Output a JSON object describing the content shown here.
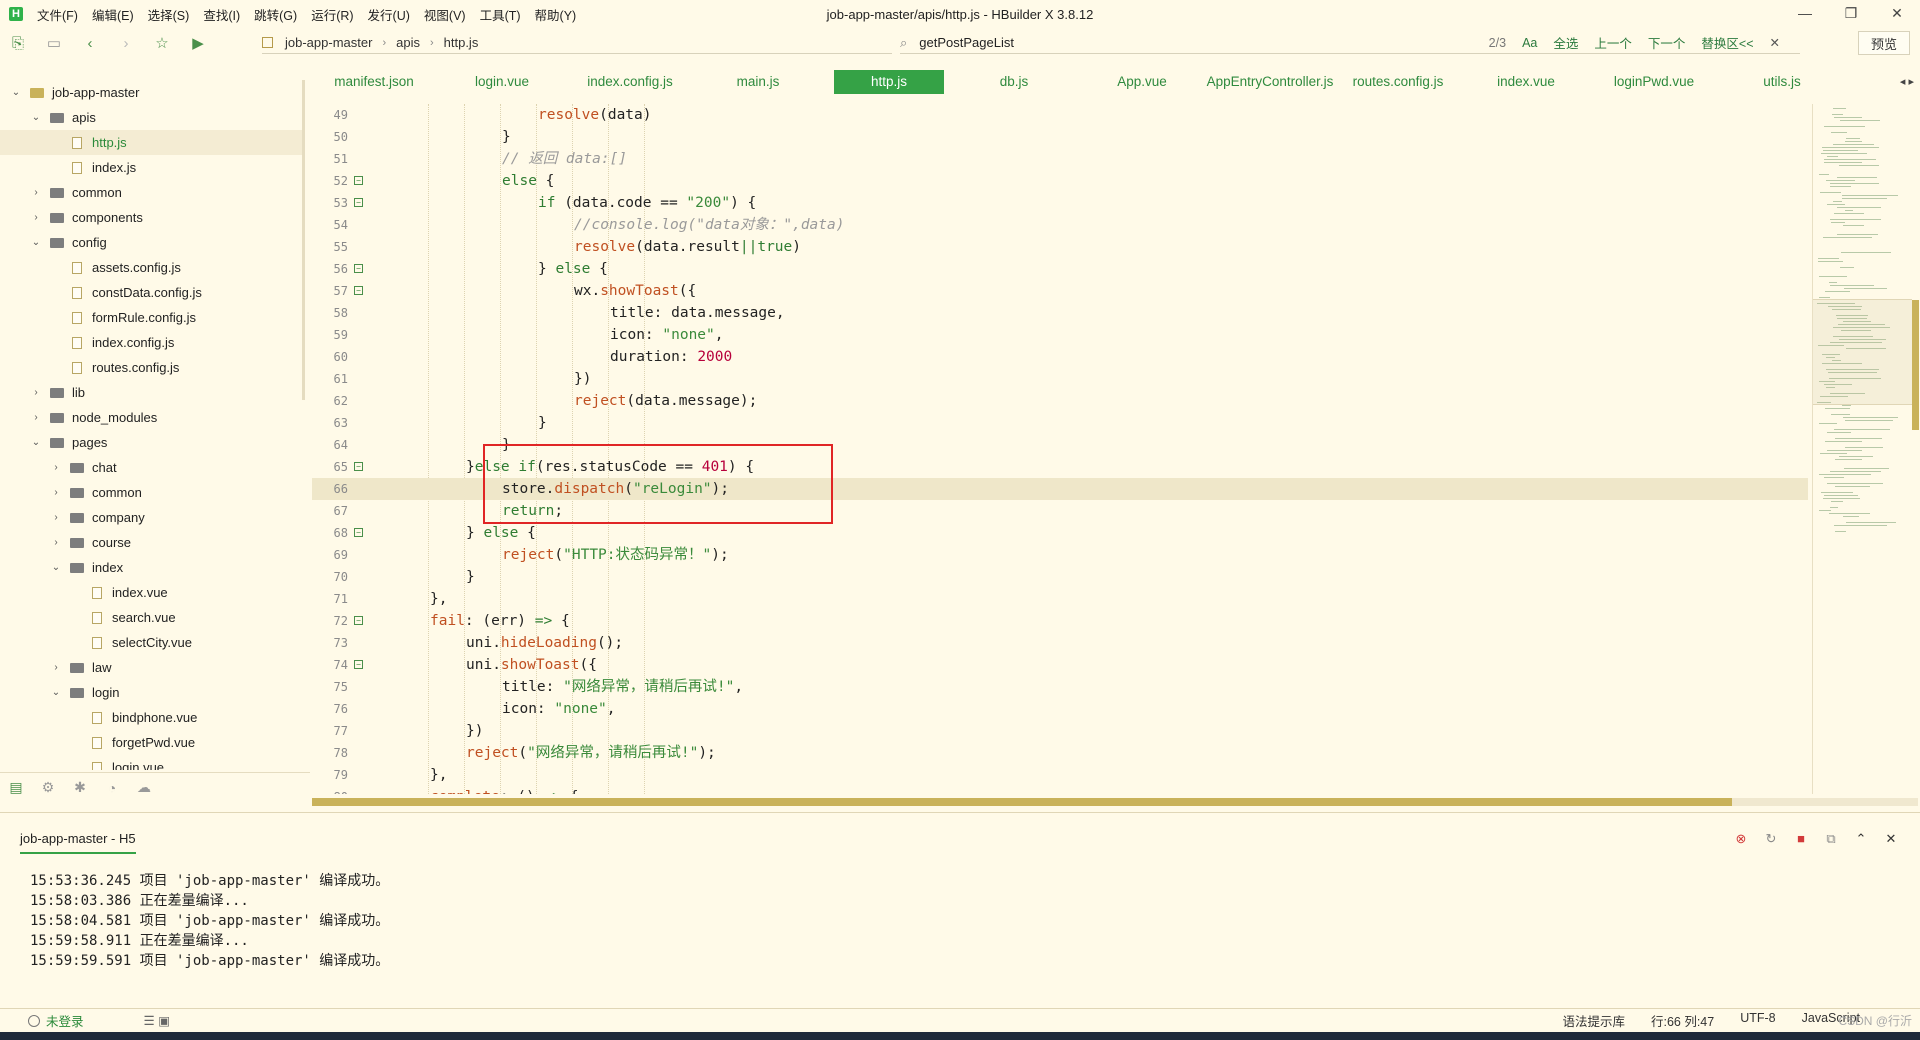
{
  "app": {
    "title": "job-app-master/apis/http.js - HBuilder X 3.8.12",
    "logo_letter": "H",
    "menu": [
      "文件(F)",
      "编辑(E)",
      "选择(S)",
      "查找(I)",
      "跳转(G)",
      "运行(R)",
      "发行(U)",
      "视图(V)",
      "工具(T)",
      "帮助(Y)"
    ]
  },
  "toolbar": {
    "breadcrumb": [
      "job-app-master",
      "apis",
      "http.js"
    ],
    "search_value": "getPostPageList",
    "search_count": "2/3",
    "search_options": [
      "Aa",
      "全选",
      "上一个",
      "下一个",
      "替换区<<"
    ],
    "preview_label": "预览"
  },
  "sidebar": {
    "items": [
      {
        "label": "job-app-master",
        "type": "project",
        "depth": 0,
        "expanded": true
      },
      {
        "label": "apis",
        "type": "folder",
        "depth": 1,
        "expanded": true
      },
      {
        "label": "http.js",
        "type": "file",
        "depth": 2,
        "selected": true
      },
      {
        "label": "index.js",
        "type": "file",
        "depth": 2
      },
      {
        "label": "common",
        "type": "folder",
        "depth": 1,
        "expanded": false
      },
      {
        "label": "components",
        "type": "folder",
        "depth": 1,
        "expanded": false
      },
      {
        "label": "config",
        "type": "folder",
        "depth": 1,
        "expanded": true
      },
      {
        "label": "assets.config.js",
        "type": "file",
        "depth": 2
      },
      {
        "label": "constData.config.js",
        "type": "file",
        "depth": 2
      },
      {
        "label": "formRule.config.js",
        "type": "file",
        "depth": 2
      },
      {
        "label": "index.config.js",
        "type": "file",
        "depth": 2
      },
      {
        "label": "routes.config.js",
        "type": "file",
        "depth": 2
      },
      {
        "label": "lib",
        "type": "folder",
        "depth": 1,
        "expanded": false
      },
      {
        "label": "node_modules",
        "type": "folder",
        "depth": 1,
        "expanded": false
      },
      {
        "label": "pages",
        "type": "folder",
        "depth": 1,
        "expanded": true
      },
      {
        "label": "chat",
        "type": "folder",
        "depth": 2,
        "expanded": false
      },
      {
        "label": "common",
        "type": "folder",
        "depth": 2,
        "expanded": false
      },
      {
        "label": "company",
        "type": "folder",
        "depth": 2,
        "expanded": false
      },
      {
        "label": "course",
        "type": "folder",
        "depth": 2,
        "expanded": false
      },
      {
        "label": "index",
        "type": "folder",
        "depth": 2,
        "expanded": true
      },
      {
        "label": "index.vue",
        "type": "file",
        "depth": 3
      },
      {
        "label": "search.vue",
        "type": "file",
        "depth": 3
      },
      {
        "label": "selectCity.vue",
        "type": "file",
        "depth": 3
      },
      {
        "label": "law",
        "type": "folder",
        "depth": 2,
        "expanded": false
      },
      {
        "label": "login",
        "type": "folder",
        "depth": 2,
        "expanded": true
      },
      {
        "label": "bindphone.vue",
        "type": "file",
        "depth": 3
      },
      {
        "label": "forgetPwd.vue",
        "type": "file",
        "depth": 3
      },
      {
        "label": "login.vue",
        "type": "file",
        "depth": 3
      }
    ]
  },
  "tabs": [
    {
      "label": "manifest.json"
    },
    {
      "label": "login.vue"
    },
    {
      "label": "index.config.js"
    },
    {
      "label": "main.js"
    },
    {
      "label": "http.js",
      "active": true
    },
    {
      "label": "db.js"
    },
    {
      "label": "App.vue"
    },
    {
      "label": "AppEntryController.js"
    },
    {
      "label": "routes.config.js"
    },
    {
      "label": "index.vue"
    },
    {
      "label": "loginPwd.vue"
    },
    {
      "label": "utils.js"
    }
  ],
  "editor": {
    "current_line": 66,
    "highlighted_lines": [
      65,
      66,
      67
    ],
    "lines": [
      {
        "n": "49",
        "indent": 6,
        "fold": false,
        "tokens": [
          [
            "fn",
            "resolve"
          ],
          [
            "p",
            "(data)"
          ]
        ]
      },
      {
        "n": "50",
        "indent": 5,
        "fold": false,
        "tokens": [
          [
            "p",
            "}"
          ]
        ]
      },
      {
        "n": "51",
        "indent": 5,
        "fold": false,
        "tokens": [
          [
            "cmt",
            "// 返回 data:[]"
          ]
        ]
      },
      {
        "n": "52",
        "indent": 5,
        "fold": true,
        "tokens": [
          [
            "kw",
            "else"
          ],
          [
            "p",
            " {"
          ]
        ]
      },
      {
        "n": "53",
        "indent": 6,
        "fold": true,
        "tokens": [
          [
            "kw",
            "if"
          ],
          [
            "p",
            " (data.code == "
          ],
          [
            "str",
            "\"200\""
          ],
          [
            "p",
            ") {"
          ]
        ]
      },
      {
        "n": "54",
        "indent": 7,
        "fold": false,
        "tokens": [
          [
            "cmt",
            "//console.log(\"data对象：\",data)"
          ]
        ]
      },
      {
        "n": "55",
        "indent": 7,
        "fold": false,
        "tokens": [
          [
            "fn",
            "resolve"
          ],
          [
            "p",
            "(data.result"
          ],
          [
            "kw",
            "||"
          ],
          [
            "kw",
            "true"
          ],
          [
            "p",
            ")"
          ]
        ]
      },
      {
        "n": "56",
        "indent": 6,
        "fold": true,
        "tokens": [
          [
            "p",
            "} "
          ],
          [
            "kw",
            "else"
          ],
          [
            "p",
            " {"
          ]
        ]
      },
      {
        "n": "57",
        "indent": 7,
        "fold": true,
        "tokens": [
          [
            "p",
            "wx."
          ],
          [
            "fn",
            "showToast"
          ],
          [
            "p",
            "({"
          ]
        ]
      },
      {
        "n": "58",
        "indent": 8,
        "fold": false,
        "tokens": [
          [
            "p",
            "title: data.message,"
          ]
        ]
      },
      {
        "n": "59",
        "indent": 8,
        "fold": false,
        "tokens": [
          [
            "p",
            "icon: "
          ],
          [
            "str",
            "\"none\""
          ],
          [
            "p",
            ","
          ]
        ]
      },
      {
        "n": "60",
        "indent": 8,
        "fold": false,
        "tokens": [
          [
            "p",
            "duration: "
          ],
          [
            "num",
            "2000"
          ]
        ]
      },
      {
        "n": "61",
        "indent": 7,
        "fold": false,
        "tokens": [
          [
            "p",
            "})"
          ]
        ]
      },
      {
        "n": "62",
        "indent": 7,
        "fold": false,
        "tokens": [
          [
            "fn",
            "reject"
          ],
          [
            "p",
            "(data.message);"
          ]
        ]
      },
      {
        "n": "63",
        "indent": 6,
        "fold": false,
        "tokens": [
          [
            "p",
            "}"
          ]
        ]
      },
      {
        "n": "64",
        "indent": 5,
        "fold": false,
        "tokens": [
          [
            "p",
            "}"
          ]
        ]
      },
      {
        "n": "65",
        "indent": 4,
        "fold": true,
        "tokens": [
          [
            "p",
            "}"
          ],
          [
            "kw",
            "else if"
          ],
          [
            "p",
            "(res.statusCode == "
          ],
          [
            "num",
            "401"
          ],
          [
            "p",
            ") {"
          ]
        ]
      },
      {
        "n": "66",
        "indent": 5,
        "fold": false,
        "tokens": [
          [
            "p",
            "store."
          ],
          [
            "fn",
            "dispatch"
          ],
          [
            "p",
            "("
          ],
          [
            "str",
            "\"reLogin\""
          ],
          [
            "p",
            ");"
          ]
        ]
      },
      {
        "n": "67",
        "indent": 5,
        "fold": false,
        "tokens": [
          [
            "kw",
            "return"
          ],
          [
            "p",
            ";"
          ]
        ]
      },
      {
        "n": "68",
        "indent": 4,
        "fold": true,
        "tokens": [
          [
            "p",
            "} "
          ],
          [
            "kw",
            "else"
          ],
          [
            "p",
            " {"
          ]
        ]
      },
      {
        "n": "69",
        "indent": 5,
        "fold": false,
        "tokens": [
          [
            "fn",
            "reject"
          ],
          [
            "p",
            "("
          ],
          [
            "str",
            "\"HTTP:状态码异常！\""
          ],
          [
            "p",
            ");"
          ]
        ]
      },
      {
        "n": "70",
        "indent": 4,
        "fold": false,
        "tokens": [
          [
            "p",
            "}"
          ]
        ]
      },
      {
        "n": "71",
        "indent": 3,
        "fold": false,
        "tokens": [
          [
            "p",
            "},"
          ]
        ]
      },
      {
        "n": "72",
        "indent": 3,
        "fold": true,
        "tokens": [
          [
            "fn",
            "fail"
          ],
          [
            "p",
            ": (err) "
          ],
          [
            "kw",
            "=>"
          ],
          [
            "p",
            " {"
          ]
        ]
      },
      {
        "n": "73",
        "indent": 4,
        "fold": false,
        "tokens": [
          [
            "p",
            "uni."
          ],
          [
            "fn",
            "hideLoading"
          ],
          [
            "p",
            "();"
          ]
        ]
      },
      {
        "n": "74",
        "indent": 4,
        "fold": true,
        "tokens": [
          [
            "p",
            "uni."
          ],
          [
            "fn",
            "showToast"
          ],
          [
            "p",
            "({"
          ]
        ]
      },
      {
        "n": "75",
        "indent": 5,
        "fold": false,
        "tokens": [
          [
            "p",
            "title: "
          ],
          [
            "str",
            "\"网络异常，请稍后再试!\""
          ],
          [
            "p",
            ","
          ]
        ]
      },
      {
        "n": "76",
        "indent": 5,
        "fold": false,
        "tokens": [
          [
            "p",
            "icon: "
          ],
          [
            "str",
            "\"none\""
          ],
          [
            "p",
            ","
          ]
        ]
      },
      {
        "n": "77",
        "indent": 4,
        "fold": false,
        "tokens": [
          [
            "p",
            "})"
          ]
        ]
      },
      {
        "n": "78",
        "indent": 4,
        "fold": false,
        "tokens": [
          [
            "fn",
            "reject"
          ],
          [
            "p",
            "("
          ],
          [
            "str",
            "\"网络异常，请稍后再试!\""
          ],
          [
            "p",
            ");"
          ]
        ]
      },
      {
        "n": "79",
        "indent": 3,
        "fold": false,
        "tokens": [
          [
            "p",
            "},"
          ]
        ]
      },
      {
        "n": "80",
        "indent": 3,
        "fold": false,
        "tokens": [
          [
            "fn",
            "complete"
          ],
          [
            "p",
            ": () "
          ],
          [
            "kw",
            "=>"
          ],
          [
            "p",
            " {"
          ]
        ]
      }
    ]
  },
  "console": {
    "tab_label": "job-app-master - H5",
    "lines": [
      "15:53:36.245 项目 'job-app-master' 编译成功。",
      "15:58:03.386 正在差量编译...",
      "15:58:04.581 项目 'job-app-master' 编译成功。",
      "15:59:58.911 正在差量编译...",
      "15:59:59.591 项目 'job-app-master' 编译成功。"
    ]
  },
  "statusbar": {
    "login": "未登录",
    "syntax_hint": "语法提示库",
    "position": "行:66  列:47",
    "encoding": "UTF-8",
    "language": "JavaScript",
    "watermark": "CSDN @行沂"
  },
  "colors": {
    "background": "#fffae8",
    "accent": "#35a246",
    "highlight_box": "#e02525"
  }
}
